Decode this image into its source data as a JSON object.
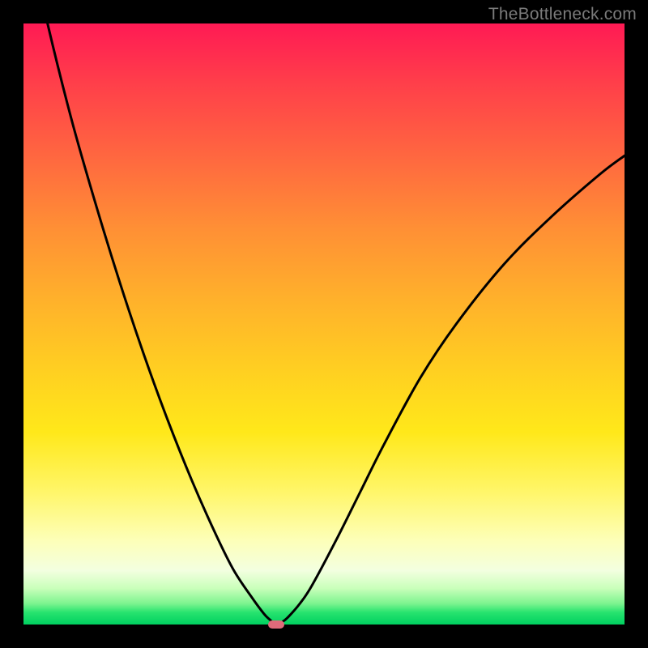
{
  "watermark": {
    "text": "TheBottleneck.com"
  },
  "colors": {
    "frame": "#000000",
    "curve": "#000000",
    "marker": "#e06a7a",
    "gradient_stops": [
      "#ff1a54",
      "#ff3f4a",
      "#ff6a3f",
      "#ff8f35",
      "#ffb12b",
      "#ffd021",
      "#ffe81a",
      "#fff66a",
      "#fdffb8",
      "#f3ffe0",
      "#c9ffba",
      "#7df48f",
      "#27e36e",
      "#00d060"
    ]
  },
  "chart_data": {
    "type": "line",
    "title": "",
    "xlabel": "",
    "ylabel": "",
    "xlim": [
      0,
      100
    ],
    "ylim": [
      0,
      100
    ],
    "grid": false,
    "legend": false,
    "annotations": [],
    "minimum_marker": {
      "x": 42,
      "y": 0,
      "shape": "pill",
      "color": "#e06a7a"
    },
    "series": [
      {
        "name": "bottleneck-curve",
        "x": [
          0,
          4,
          8,
          12,
          16,
          20,
          24,
          28,
          32,
          35,
          38,
          40,
          41,
          42,
          43,
          44,
          46,
          48,
          52,
          56,
          60,
          66,
          72,
          80,
          88,
          96,
          100
        ],
        "y": [
          118,
          100,
          84,
          70,
          57,
          45,
          34,
          24,
          15,
          9,
          4.5,
          1.8,
          0.8,
          0,
          0.4,
          1.2,
          3.5,
          6.5,
          14,
          22,
          30,
          41,
          50,
          60,
          68,
          75,
          78
        ]
      }
    ]
  }
}
